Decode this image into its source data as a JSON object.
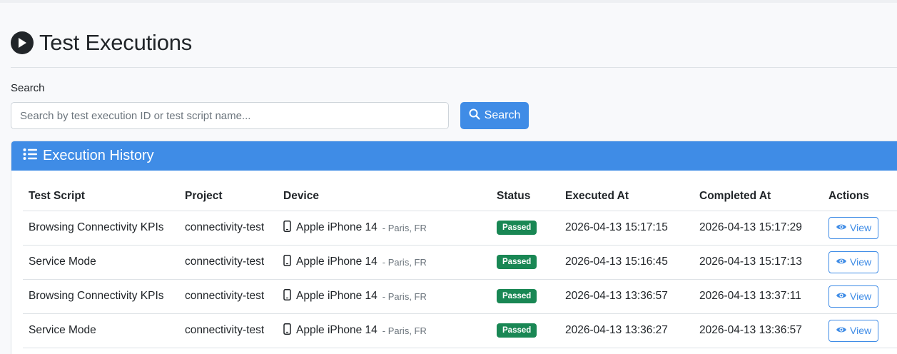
{
  "page": {
    "title": "Test Executions"
  },
  "search": {
    "label": "Search",
    "placeholder": "Search by test execution ID or test script name...",
    "value": "",
    "button_label": "Search"
  },
  "history": {
    "title": "Execution History",
    "columns": [
      "Test Script",
      "Project",
      "Device",
      "Status",
      "Executed At",
      "Completed At",
      "Actions"
    ],
    "rows": [
      {
        "script": "Browsing Connectivity KPIs",
        "project": "connectivity-test",
        "device": "Apple iPhone 14",
        "location": "- Paris, FR",
        "status": "Passed",
        "executed_at": "2026-04-13 15:17:15",
        "completed_at": "2026-04-13 15:17:29",
        "action": "View"
      },
      {
        "script": "Service Mode",
        "project": "connectivity-test",
        "device": "Apple iPhone 14",
        "location": "- Paris, FR",
        "status": "Passed",
        "executed_at": "2026-04-13 15:16:45",
        "completed_at": "2026-04-13 15:17:13",
        "action": "View"
      },
      {
        "script": "Browsing Connectivity KPIs",
        "project": "connectivity-test",
        "device": "Apple iPhone 14",
        "location": "- Paris, FR",
        "status": "Passed",
        "executed_at": "2026-04-13 13:36:57",
        "completed_at": "2026-04-13 13:37:11",
        "action": "View"
      },
      {
        "script": "Service Mode",
        "project": "connectivity-test",
        "device": "Apple iPhone 14",
        "location": "- Paris, FR",
        "status": "Passed",
        "executed_at": "2026-04-13 13:36:27",
        "completed_at": "2026-04-13 13:36:57",
        "action": "View"
      }
    ]
  },
  "icons": {
    "title": "play-circle-icon",
    "search": "search-icon",
    "header": "list-icon",
    "device": "phone-icon",
    "view": "eye-icon"
  },
  "colors": {
    "primary": "#3f8ce6",
    "success": "#198754"
  }
}
